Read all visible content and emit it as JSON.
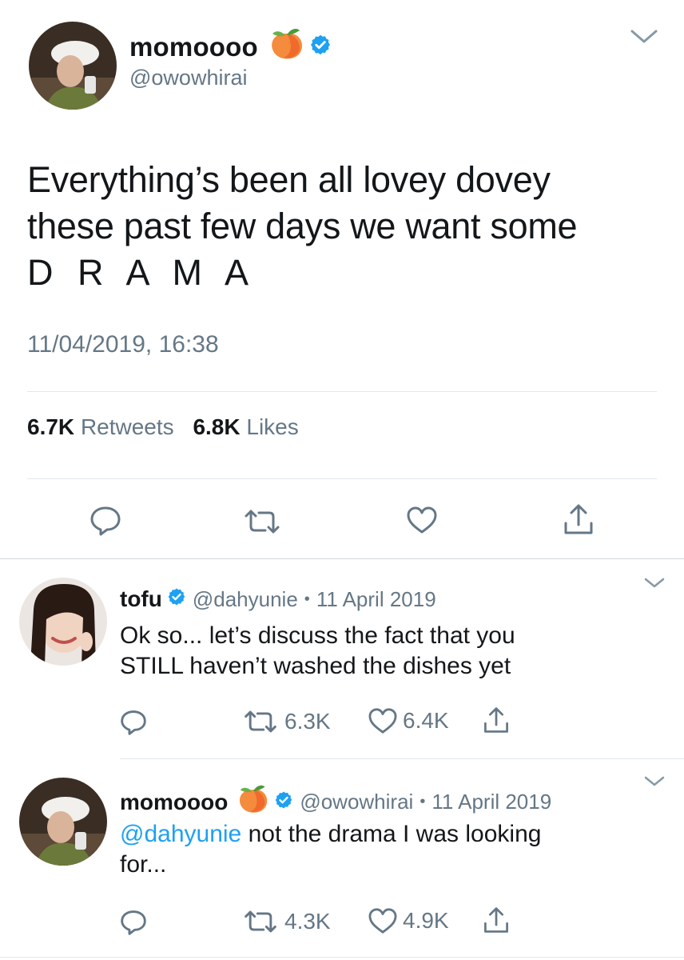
{
  "main_tweet": {
    "display_name": "momoooo",
    "handle": "@owowhirai",
    "text_lines": [
      "Everything’s been all lovey dovey",
      "these past few days we want some",
      "D R A M A"
    ],
    "timestamp": "11/04/2019, 16:38",
    "retweets_count": "6.7K",
    "retweets_label": "Retweets",
    "likes_count": "6.8K",
    "likes_label": "Likes"
  },
  "replies": [
    {
      "display_name": "tofu",
      "handle": "@dahyunie",
      "separator": "•",
      "date": "11 April 2019",
      "text_lines": [
        "Ok so... let’s discuss the fact that you",
        "STILL haven’t washed the dishes yet"
      ],
      "retweets": "6.3K",
      "likes": "6.4K"
    },
    {
      "display_name": "momoooo",
      "handle": "@owowhirai",
      "separator": "•",
      "date": "11 April 2019",
      "mention": "@dahyunie",
      "text_rest": " not the drama I was looking",
      "text_line2": "for...",
      "retweets": "4.3K",
      "likes": "4.9K"
    }
  ],
  "icons": {
    "reply": "reply-icon",
    "retweet": "retweet-icon",
    "like": "heart-icon",
    "share": "share-icon",
    "verified": "verified-badge-icon",
    "emoji": "peach-emoji-icon",
    "menu": "chevron-down-icon"
  },
  "colors": {
    "verified_blue": "#1da1f2",
    "secondary_text": "#657786",
    "primary_text": "#14171a",
    "divider": "#e1e8ed"
  }
}
